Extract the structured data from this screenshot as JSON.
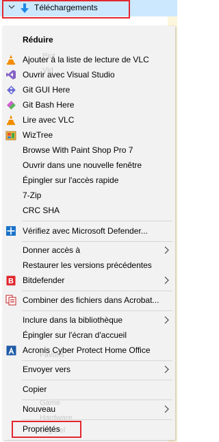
{
  "tree": {
    "folder_label": "Téléchargements"
  },
  "ghost_text": [
    "Pict",
    "Vid",
    "Favoris",
    "Game",
    "Hardware",
    "Logiciel"
  ],
  "menu": {
    "items": [
      {
        "label": "Réduire",
        "bold": true
      },
      {
        "label": "Ajouter à la liste de lecture de VLC",
        "icon": "vlc-icon"
      },
      {
        "label": "Ouvrir avec Visual Studio",
        "icon": "visual-studio-icon"
      },
      {
        "label": "Git GUI Here",
        "icon": "git-gui-icon"
      },
      {
        "label": "Git Bash Here",
        "icon": "git-bash-icon"
      },
      {
        "label": "Lire avec VLC",
        "icon": "vlc-icon"
      },
      {
        "label": "WizTree",
        "icon": "wiztree-icon"
      },
      {
        "label": "Browse With Paint Shop Pro 7"
      },
      {
        "label": "Ouvrir dans une nouvelle fenêtre"
      },
      {
        "label": "Épingler sur l'accès rapide"
      },
      {
        "label": "7-Zip"
      },
      {
        "label": "CRC SHA"
      },
      {
        "label": "Vérifiez avec Microsoft Defender...",
        "icon": "defender-icon"
      },
      {
        "label": "Donner accès à",
        "submenu": true
      },
      {
        "label": "Restaurer les versions précédentes"
      },
      {
        "label": "Bitdefender",
        "icon": "bitdefender-icon",
        "submenu": true
      },
      {
        "label": "Combiner des fichiers dans Acrobat...",
        "icon": "acrobat-icon"
      },
      {
        "label": "Inclure dans la bibliothèque",
        "submenu": true
      },
      {
        "label": "Épingler sur l'écran d'accueil"
      },
      {
        "label": "Acronis Cyber Protect Home Office",
        "icon": "acronis-icon"
      },
      {
        "label": "Envoyer vers",
        "submenu": true
      },
      {
        "label": "Copier"
      },
      {
        "label": "Nouveau",
        "submenu": true
      },
      {
        "label": "Propriétés"
      }
    ]
  },
  "colors": {
    "highlight_box": "#e3262f",
    "tree_selection": "#cce8ff",
    "menu_bg": "#f2f2f2"
  }
}
